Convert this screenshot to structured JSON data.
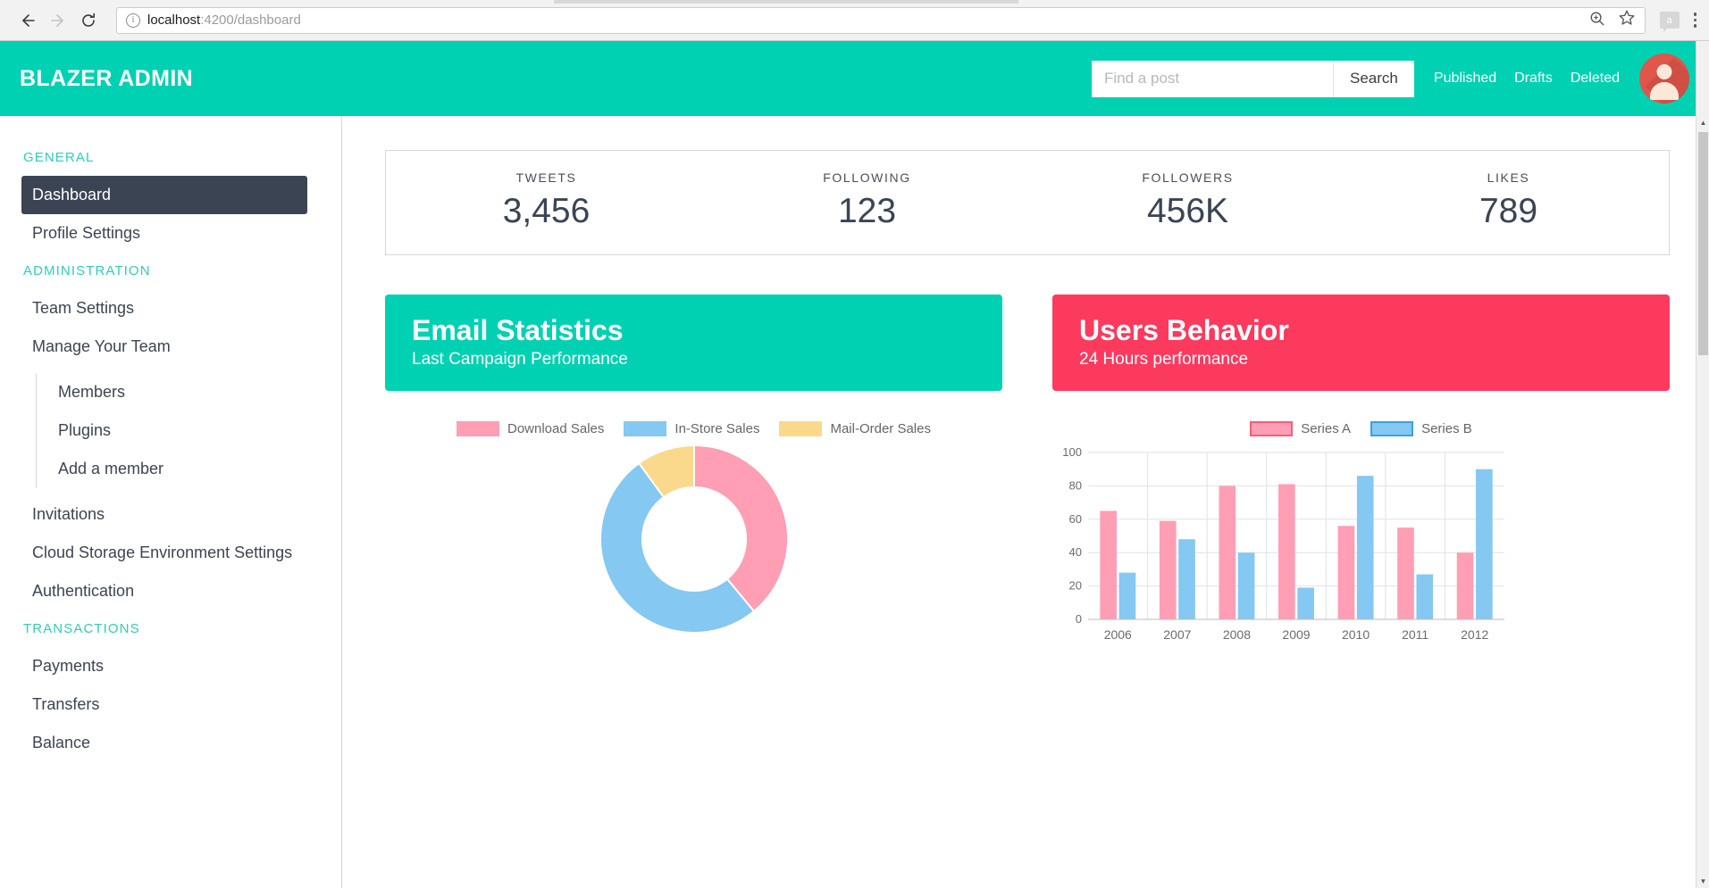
{
  "browser": {
    "back_icon": "back-arrow-icon",
    "forward_icon": "forward-arrow-icon",
    "reload_icon": "reload-icon",
    "info_glyph": "i",
    "url_host": "localhost",
    "url_path": ":4200/dashboard",
    "zoom_icon": "zoom-in-icon",
    "bookmark_icon": "star-icon",
    "extension_label": "a",
    "menu_icon": "three-dot-menu-icon"
  },
  "header": {
    "brand": "BLAZER ADMIN",
    "search": {
      "value": "",
      "placeholder": "Find a post",
      "button_label": "Search"
    },
    "links": [
      "Published",
      "Drafts",
      "Deleted"
    ],
    "avatar_alt": "user-avatar"
  },
  "sidebar": {
    "groups": [
      {
        "title": "GENERAL",
        "items": [
          {
            "label": "Dashboard",
            "active": true
          },
          {
            "label": "Profile Settings",
            "active": false
          }
        ]
      },
      {
        "title": "ADMINISTRATION",
        "items": [
          {
            "label": "Team Settings",
            "active": false
          },
          {
            "label": "Manage Your Team",
            "active": false
          }
        ],
        "sub_items": [
          {
            "label": "Members"
          },
          {
            "label": "Plugins"
          },
          {
            "label": "Add a member"
          }
        ],
        "items_after": [
          {
            "label": "Invitations"
          },
          {
            "label": "Cloud Storage Environment Settings"
          },
          {
            "label": "Authentication"
          }
        ]
      },
      {
        "title": "TRANSACTIONS",
        "items": [
          {
            "label": "Payments",
            "active": false
          },
          {
            "label": "Transfers",
            "active": false
          },
          {
            "label": "Balance",
            "active": false
          }
        ]
      }
    ]
  },
  "stats": [
    {
      "label": "TWEETS",
      "value": "3,456"
    },
    {
      "label": "FOLLOWING",
      "value": "123"
    },
    {
      "label": "FOLLOWERS",
      "value": "456K"
    },
    {
      "label": "LIKES",
      "value": "789"
    }
  ],
  "cards": {
    "email": {
      "title": "Email Statistics",
      "subtitle": "Last Campaign Performance",
      "color": "#00d1b2"
    },
    "users": {
      "title": "Users Behavior",
      "subtitle": "24 Hours performance",
      "color": "#fb3a5e"
    }
  },
  "chart_data": [
    {
      "type": "pie",
      "title": "Email Statistics",
      "subtitle": "Last Campaign Performance",
      "variant": "doughnut",
      "legend_position": "top",
      "categories": [
        "Download Sales",
        "In-Store Sales",
        "Mail-Order Sales"
      ],
      "values": [
        39,
        51,
        10
      ],
      "colors": [
        "#ff9eb5",
        "#85c8f2",
        "#fbd98c"
      ]
    },
    {
      "type": "bar",
      "title": "Users Behavior",
      "subtitle": "24 Hours performance",
      "legend_position": "top",
      "categories": [
        "2006",
        "2007",
        "2008",
        "2009",
        "2010",
        "2011",
        "2012"
      ],
      "series": [
        {
          "name": "Series A",
          "values": [
            65,
            59,
            80,
            81,
            56,
            55,
            40
          ],
          "color": "#ff9eb5",
          "border": "#fb5c7c"
        },
        {
          "name": "Series B",
          "values": [
            28,
            48,
            40,
            19,
            86,
            27,
            90
          ],
          "color": "#85c8f2",
          "border": "#3f9fe0"
        }
      ],
      "xlabel": "",
      "ylabel": "",
      "ylim": [
        0,
        100
      ],
      "yticks": [
        0,
        20,
        40,
        60,
        80,
        100
      ],
      "grid": true
    }
  ]
}
